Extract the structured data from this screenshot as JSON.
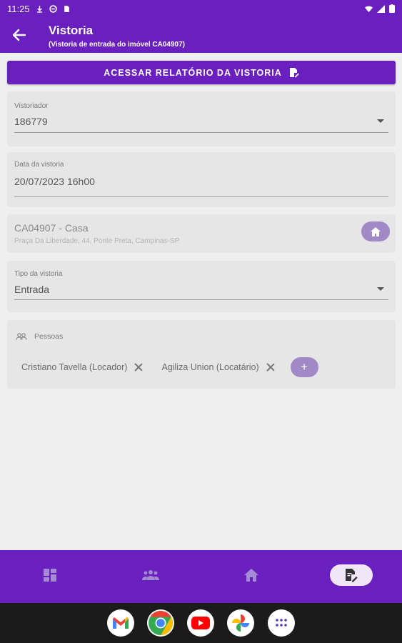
{
  "status_bar": {
    "time": "11:25"
  },
  "app_bar": {
    "title": "Vistoria",
    "subtitle": "(Vistoria de entrada do imóvel CA04907)"
  },
  "report_button": {
    "label": "ACESSAR RELATÓRIO DA VISTORIA",
    "icon": "document-edit-icon"
  },
  "inspector": {
    "label": "Vistoriador",
    "value": "186779"
  },
  "date": {
    "label": "Data da vistoria",
    "value": "20/07/2023 16h00"
  },
  "property": {
    "title": "CA04907 - Casa",
    "address": "Praça Da Liberdade, 44, Ponte Preta, Campinas-SP",
    "icon": "home-icon"
  },
  "inspection_type": {
    "label": "Tipo da vistoria",
    "value": "Entrada"
  },
  "people": {
    "label": "Pessoas",
    "icon": "people-icon",
    "chips": [
      {
        "name": "Cristiano Tavella (Locador)"
      },
      {
        "name": "Agiliza Union (Locatário)"
      }
    ],
    "add_label": "+"
  },
  "bottom_nav": {
    "items": [
      {
        "icon": "dashboard-icon",
        "active": false
      },
      {
        "icon": "people-icon",
        "active": false
      },
      {
        "icon": "home-icon",
        "active": false
      },
      {
        "icon": "document-edit-icon",
        "active": true
      }
    ]
  },
  "dock": {
    "apps": [
      "gmail-icon",
      "chrome-icon",
      "youtube-icon",
      "photos-icon",
      "app-drawer-icon"
    ]
  },
  "colors": {
    "primary": "#6a1fbf",
    "chip_button": "#a089c6",
    "background": "#efefef",
    "card": "#e6e6e6"
  }
}
